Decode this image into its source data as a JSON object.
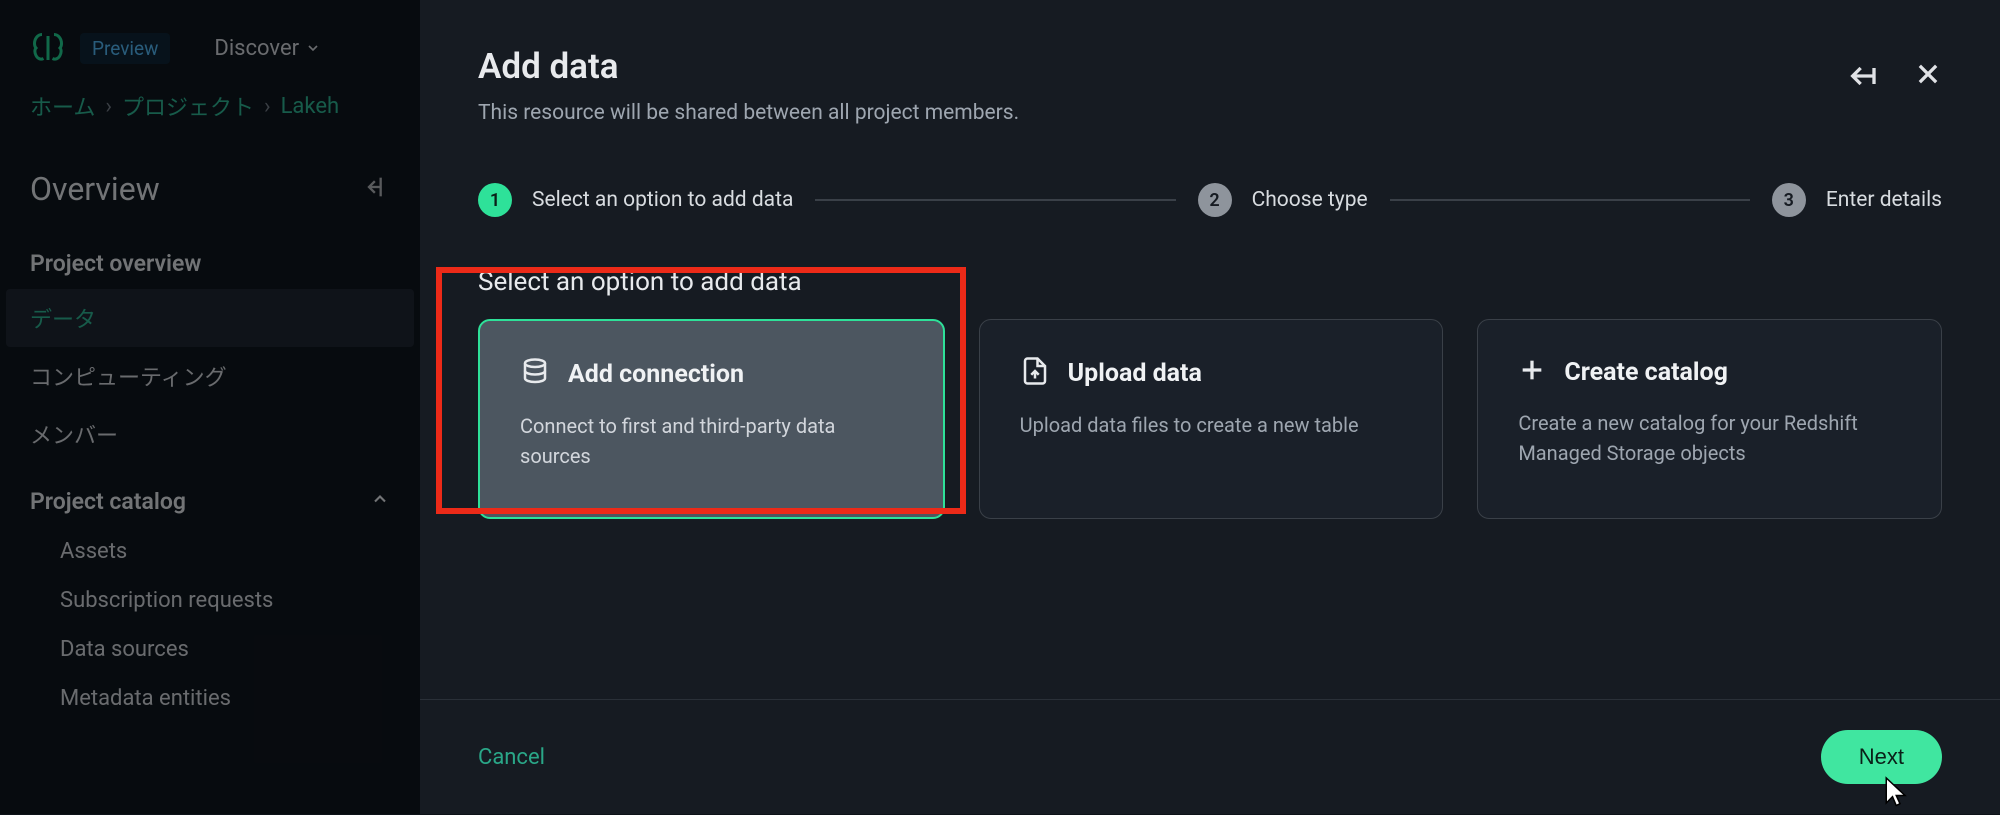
{
  "topbar": {
    "preview_badge": "Preview",
    "discover": "Discover"
  },
  "breadcrumb": [
    "ホーム",
    "プロジェクト",
    "Lakeh"
  ],
  "sidebar": {
    "overview_title": "Overview",
    "project_overview": "Project overview",
    "items": [
      "データ",
      "コンピューティング",
      "メンバー"
    ],
    "catalog_title": "Project catalog",
    "catalog_items": [
      "Assets",
      "Subscription requests",
      "Data sources",
      "Metadata entities"
    ]
  },
  "panel": {
    "title": "Add data",
    "subtitle": "This resource will be shared between all project members."
  },
  "stepper": {
    "step1": "Select an option to add data",
    "step2": "Choose type",
    "step3": "Enter details"
  },
  "section": {
    "title": "Select an option to add data"
  },
  "cards": {
    "connection": {
      "title": "Add connection",
      "desc": "Connect to first and third-party data sources"
    },
    "upload": {
      "title": "Upload data",
      "desc": "Upload data files to create a new table"
    },
    "catalog": {
      "title": "Create catalog",
      "desc": "Create a new catalog for your Redshift Managed Storage objects"
    }
  },
  "footer": {
    "cancel": "Cancel",
    "next": "Next"
  }
}
